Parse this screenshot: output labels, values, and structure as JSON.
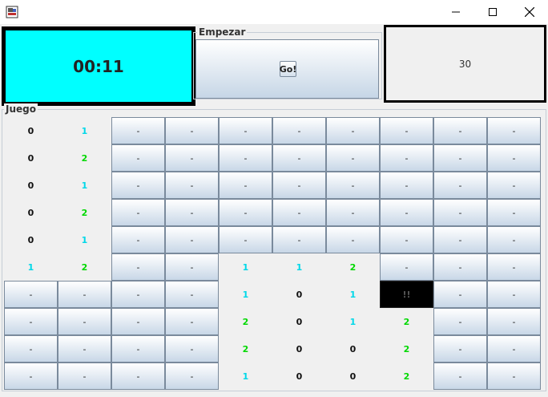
{
  "window": {
    "icons": {
      "app": "app-icon",
      "minimize": "minimize-icon",
      "maximize": "maximize-icon",
      "close": "close-icon"
    }
  },
  "timer": {
    "value": "00:11",
    "color": "#00ffff"
  },
  "start": {
    "legend": "Empezar",
    "button_label": "Go!"
  },
  "counter": {
    "value": "30"
  },
  "game": {
    "legend": "Juego",
    "colors": {
      "zero": "#111111",
      "one": "#00d8e8",
      "two": "#00d800",
      "flag_bg": "#000000"
    },
    "cells": [
      [
        "0",
        "1",
        "-",
        "-",
        "-",
        "-",
        "-",
        "-",
        "-",
        "-"
      ],
      [
        "0",
        "2",
        "-",
        "-",
        "-",
        "-",
        "-",
        "-",
        "-",
        "-"
      ],
      [
        "0",
        "1",
        "-",
        "-",
        "-",
        "-",
        "-",
        "-",
        "-",
        "-"
      ],
      [
        "0",
        "2",
        "-",
        "-",
        "-",
        "-",
        "-",
        "-",
        "-",
        "-"
      ],
      [
        "0",
        "1",
        "-",
        "-",
        "-",
        "-",
        "-",
        "-",
        "-",
        "-"
      ],
      [
        "1",
        "2",
        "-",
        "-",
        "1",
        "1",
        "2",
        "-",
        "-",
        "-"
      ],
      [
        "-",
        "-",
        "-",
        "-",
        "1",
        "0",
        "1",
        "!!",
        "-",
        "-"
      ],
      [
        "-",
        "-",
        "-",
        "-",
        "2",
        "0",
        "1",
        "2",
        "-",
        "-"
      ],
      [
        "-",
        "-",
        "-",
        "-",
        "2",
        "0",
        "0",
        "2",
        "-",
        "-"
      ],
      [
        "-",
        "-",
        "-",
        "-",
        "1",
        "0",
        "0",
        "2",
        "-",
        "-"
      ]
    ]
  }
}
